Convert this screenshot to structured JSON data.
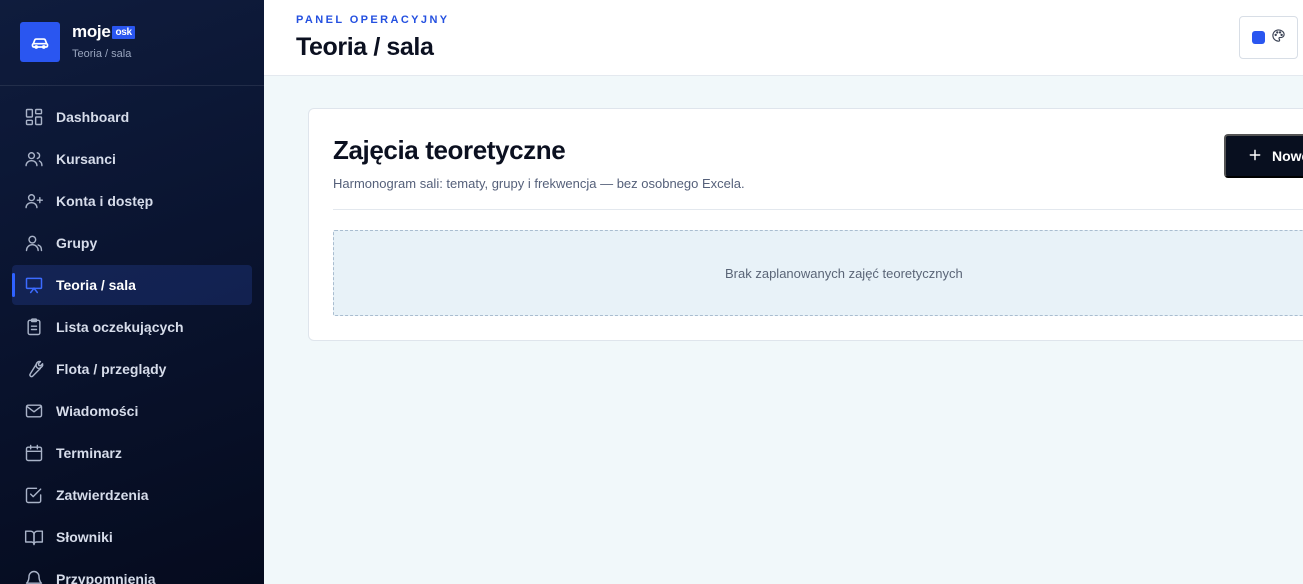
{
  "brand": {
    "name": "moje",
    "tag": "osk",
    "subtitle": "Teoria / sala",
    "accent": "#2a56f0"
  },
  "sidebar": {
    "items": [
      {
        "label": "Dashboard",
        "icon": "dashboard-icon"
      },
      {
        "label": "Kursanci",
        "icon": "users-icon"
      },
      {
        "label": "Konta i dostęp",
        "icon": "user-plus-icon"
      },
      {
        "label": "Grupy",
        "icon": "group-icon"
      },
      {
        "label": "Teoria / sala",
        "icon": "presentation-icon",
        "active": true
      },
      {
        "label": "Lista oczekujących",
        "icon": "clipboard-icon"
      },
      {
        "label": "Flota / przeglądy",
        "icon": "wrench-icon"
      },
      {
        "label": "Wiadomości",
        "icon": "mail-icon"
      },
      {
        "label": "Terminarz",
        "icon": "calendar-icon"
      },
      {
        "label": "Zatwierdzenia",
        "icon": "check-square-icon"
      },
      {
        "label": "Słowniki",
        "icon": "book-icon"
      },
      {
        "label": "Przypomnienia",
        "icon": "bell-icon"
      }
    ]
  },
  "header": {
    "eyebrow": "PANEL OPERACYJNY",
    "title": "Teoria / sala",
    "theme_swatch_color": "#2a56f0"
  },
  "main": {
    "title": "Zajęcia teoretyczne",
    "description": "Harmonogram sali: tematy, grupy i frekwencja — bez osobnego Excela.",
    "new_button_label": "Nowe",
    "empty_state": "Brak zaplanowanych zajęć teoretycznych"
  }
}
